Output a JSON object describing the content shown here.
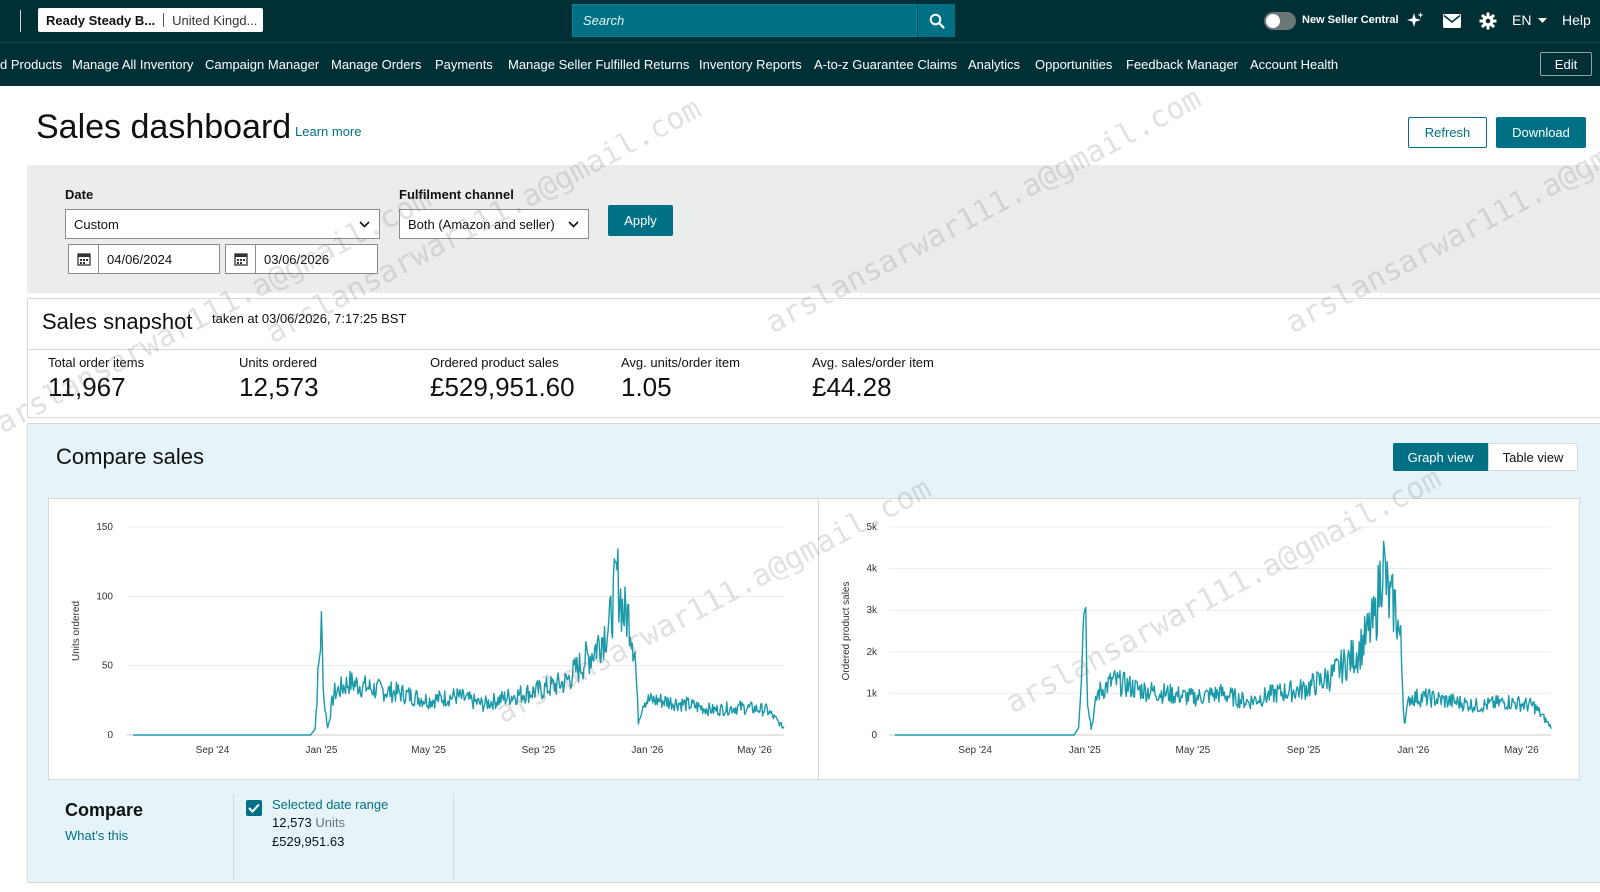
{
  "topbar": {
    "store_name": "Ready Steady B...",
    "country": "United Kingd...",
    "search_placeholder": "Search",
    "new_seller_central": "New Seller Central",
    "language": "EN",
    "help": "Help"
  },
  "nav": {
    "items": [
      "d Products",
      "Manage All Inventory",
      "Campaign Manager",
      "Manage Orders",
      "Payments",
      "Manage Seller Fulfilled Returns",
      "Inventory Reports",
      "A-to-z Guarantee Claims",
      "Analytics",
      "Opportunities",
      "Feedback Manager",
      "Account Health"
    ],
    "edit": "Edit"
  },
  "header": {
    "title": "Sales dashboard",
    "learn_more": "Learn more",
    "refresh": "Refresh",
    "download": "Download"
  },
  "filters": {
    "date_label": "Date",
    "date_value": "Custom",
    "start_date": "04/06/2024",
    "end_date": "03/06/2026",
    "channel_label": "Fulfilment channel",
    "channel_value": "Both (Amazon and seller)",
    "apply": "Apply"
  },
  "snapshot": {
    "title": "Sales snapshot",
    "taken_at": "taken at 03/06/2026, 7:17:25 BST",
    "metrics": [
      {
        "label": "Total order items",
        "value": "11,967"
      },
      {
        "label": "Units ordered",
        "value": "12,573"
      },
      {
        "label": "Ordered product sales",
        "value": "£529,951.60"
      },
      {
        "label": "Avg. units/order item",
        "value": "1.05"
      },
      {
        "label": "Avg. sales/order item",
        "value": "£44.28"
      }
    ]
  },
  "compare": {
    "title": "Compare sales",
    "graph_view": "Graph view",
    "table_view": "Table view",
    "compare_label": "Compare",
    "whats_this": "What's this",
    "range_label": "Selected date range",
    "range_units_value": "12,573",
    "range_units_unit": "Units",
    "range_sales": "£529,951.63"
  },
  "watermark": "arslansarwar111.a@gmail.com",
  "colors": {
    "nav_bg": "#002f36",
    "accent": "#007185",
    "line": "#1a9aa8",
    "panel_bg": "#e6f4fa"
  },
  "chart_data": [
    {
      "type": "line",
      "ylabel": "Units ordered",
      "x_ticks": [
        "Sep '24",
        "Jan '25",
        "May '25",
        "Sep '25",
        "Jan '26",
        "May '26"
      ],
      "y_ticks": [
        "0",
        "50",
        "100",
        "150"
      ],
      "ylim": [
        0,
        150
      ],
      "x_range": [
        "2024-06-04",
        "2026-06-03"
      ],
      "series_points": [
        [
          "2024-06-04",
          0
        ],
        [
          "2024-12-20",
          0
        ],
        [
          "2024-12-25",
          5
        ],
        [
          "2024-12-28",
          40
        ],
        [
          "2025-01-01",
          78
        ],
        [
          "2025-01-04",
          25
        ],
        [
          "2025-01-08",
          5
        ],
        [
          "2025-01-15",
          30
        ],
        [
          "2025-02-01",
          38
        ],
        [
          "2025-03-01",
          33
        ],
        [
          "2025-04-01",
          30
        ],
        [
          "2025-05-01",
          25
        ],
        [
          "2025-06-01",
          28
        ],
        [
          "2025-07-01",
          22
        ],
        [
          "2025-08-01",
          28
        ],
        [
          "2025-09-01",
          32
        ],
        [
          "2025-10-01",
          38
        ],
        [
          "2025-11-01",
          60
        ],
        [
          "2025-11-20",
          80
        ],
        [
          "2025-11-28",
          115
        ],
        [
          "2025-12-05",
          88
        ],
        [
          "2025-12-12",
          85
        ],
        [
          "2025-12-18",
          60
        ],
        [
          "2025-12-22",
          10
        ],
        [
          "2025-12-28",
          25
        ],
        [
          "2026-01-15",
          25
        ],
        [
          "2026-02-15",
          22
        ],
        [
          "2026-03-15",
          18
        ],
        [
          "2026-04-15",
          20
        ],
        [
          "2026-05-15",
          18
        ],
        [
          "2026-06-03",
          5
        ]
      ]
    },
    {
      "type": "line",
      "ylabel": "Ordered product sales",
      "x_ticks": [
        "Sep '24",
        "Jan '25",
        "May '25",
        "Sep '25",
        "Jan '26",
        "May '26"
      ],
      "y_ticks": [
        "0",
        "1k",
        "2k",
        "3k",
        "4k",
        "5k"
      ],
      "ylim": [
        0,
        5000
      ],
      "x_range": [
        "2024-06-04",
        "2026-06-03"
      ],
      "series_points": [
        [
          "2024-06-04",
          0
        ],
        [
          "2024-12-20",
          0
        ],
        [
          "2024-12-25",
          200
        ],
        [
          "2024-12-28",
          1500
        ],
        [
          "2025-01-01",
          3750
        ],
        [
          "2025-01-04",
          900
        ],
        [
          "2025-01-08",
          150
        ],
        [
          "2025-01-15",
          1000
        ],
        [
          "2025-02-01",
          1300
        ],
        [
          "2025-03-01",
          1100
        ],
        [
          "2025-04-01",
          1000
        ],
        [
          "2025-05-01",
          900
        ],
        [
          "2025-06-01",
          1000
        ],
        [
          "2025-07-01",
          800
        ],
        [
          "2025-08-01",
          1000
        ],
        [
          "2025-09-01",
          1100
        ],
        [
          "2025-10-01",
          1400
        ],
        [
          "2025-11-01",
          2000
        ],
        [
          "2025-11-20",
          2800
        ],
        [
          "2025-11-28",
          4250
        ],
        [
          "2025-12-05",
          3200
        ],
        [
          "2025-12-12",
          3100
        ],
        [
          "2025-12-18",
          2200
        ],
        [
          "2025-12-22",
          300
        ],
        [
          "2025-12-28",
          900
        ],
        [
          "2026-01-15",
          900
        ],
        [
          "2026-02-15",
          800
        ],
        [
          "2026-03-15",
          700
        ],
        [
          "2026-04-15",
          800
        ],
        [
          "2026-05-15",
          700
        ],
        [
          "2026-06-03",
          200
        ]
      ]
    }
  ]
}
